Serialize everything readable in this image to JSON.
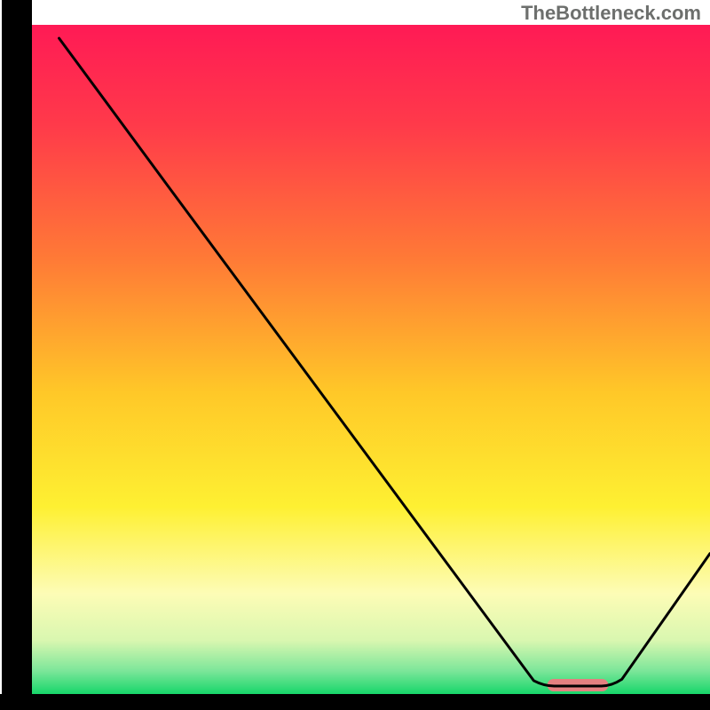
{
  "watermark": "TheBottleneck.com",
  "chart_data": {
    "type": "line",
    "title": "",
    "xlabel": "",
    "ylabel": "",
    "xlim": [
      0,
      100
    ],
    "ylim": [
      0,
      100
    ],
    "grid": false,
    "axes_visible": false,
    "background_gradient": {
      "stops": [
        {
          "offset": 0.0,
          "color": "#ff1a55"
        },
        {
          "offset": 0.15,
          "color": "#ff3a4a"
        },
        {
          "offset": 0.35,
          "color": "#ff7a36"
        },
        {
          "offset": 0.55,
          "color": "#ffc828"
        },
        {
          "offset": 0.72,
          "color": "#fef032"
        },
        {
          "offset": 0.85,
          "color": "#fdfcb6"
        },
        {
          "offset": 0.92,
          "color": "#d9f7b0"
        },
        {
          "offset": 0.965,
          "color": "#7de69a"
        },
        {
          "offset": 1.0,
          "color": "#17d66a"
        }
      ]
    },
    "curve": {
      "name": "bottleneck-curve",
      "color": "#000000",
      "points": [
        {
          "x": 4.0,
          "y": 98.0
        },
        {
          "x": 20.0,
          "y": 76.0
        },
        {
          "x": 74.0,
          "y": 2.0
        },
        {
          "x": 77.0,
          "y": 1.2
        },
        {
          "x": 84.0,
          "y": 1.2
        },
        {
          "x": 87.0,
          "y": 2.2
        },
        {
          "x": 100.0,
          "y": 21.0
        }
      ]
    },
    "optimal_range": {
      "x_start": 76,
      "x_end": 85,
      "color": "#e48080"
    }
  }
}
